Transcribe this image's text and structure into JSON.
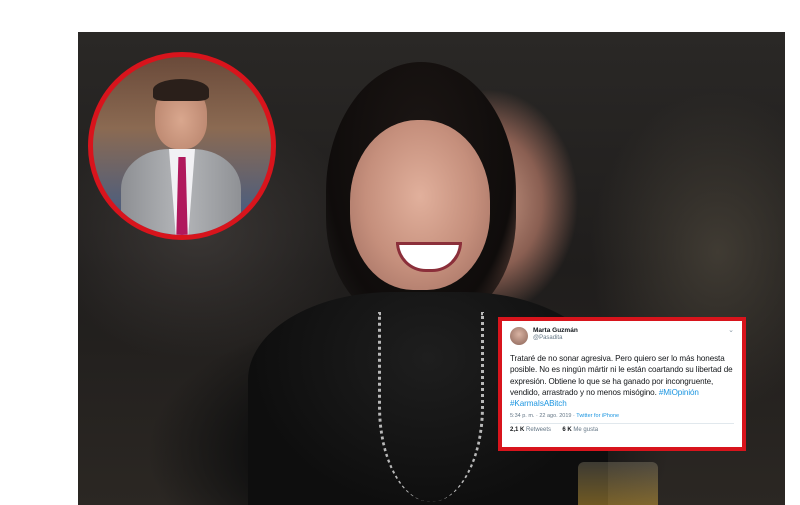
{
  "tweet": {
    "display_name": "Marta Guzmán",
    "handle": "@Pasadita",
    "text_main": "Trataré de no sonar agresiva. Pero quiero ser lo más honesta posible. No es ningún mártir ni le están coartando su libertad de expresión. Obtiene lo que se ha ganado por incongruente, vendido, arrastrado y no menos misógino.",
    "hashtag_1": "#MiOpinión",
    "hashtag_2": "#KarmaIsABitch",
    "timestamp": "5:34 p. m. · 22 ago. 2019 ·",
    "source": "Twitter for iPhone",
    "retweets_count": "2,1 K",
    "retweets_label": "Retweets",
    "likes_count": "6 K",
    "likes_label": "Me gusta"
  },
  "colors": {
    "highlight_red": "#d8141c",
    "link_blue": "#1b95e0"
  },
  "icons": {
    "tweet_menu": "chevron-down-icon"
  }
}
